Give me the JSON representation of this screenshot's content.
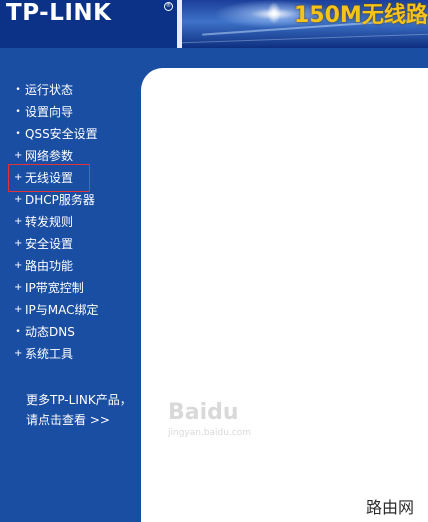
{
  "header": {
    "logo_text": "TP-LINK",
    "product_title": "150M无线路"
  },
  "sidebar": {
    "items": [
      {
        "label": "运行状态",
        "marker": "•"
      },
      {
        "label": "设置向导",
        "marker": "•",
        "selected": true
      },
      {
        "label": "QSS安全设置",
        "marker": "•"
      },
      {
        "label": "网络参数",
        "marker": "+"
      },
      {
        "label": "无线设置",
        "marker": "+"
      },
      {
        "label": "DHCP服务器",
        "marker": "+"
      },
      {
        "label": "转发规则",
        "marker": "+"
      },
      {
        "label": "安全设置",
        "marker": "+"
      },
      {
        "label": "路由功能",
        "marker": "+"
      },
      {
        "label": "IP带宽控制",
        "marker": "+"
      },
      {
        "label": "IP与MAC绑定",
        "marker": "+"
      },
      {
        "label": "动态DNS",
        "marker": "•"
      },
      {
        "label": "系统工具",
        "marker": "+"
      }
    ],
    "more_line1": "更多TP-LINK产品，",
    "more_line2": "请点击查看 >>"
  },
  "watermark": {
    "text": "Baidu",
    "url": "jingyan.baidu.com"
  },
  "site_badge": "路由网",
  "colors": {
    "sidebar_bg": "#1a4ea3",
    "header_bg": "#0c3288",
    "title_yellow": "#f6c31a",
    "selection_border": "#e0343a"
  }
}
